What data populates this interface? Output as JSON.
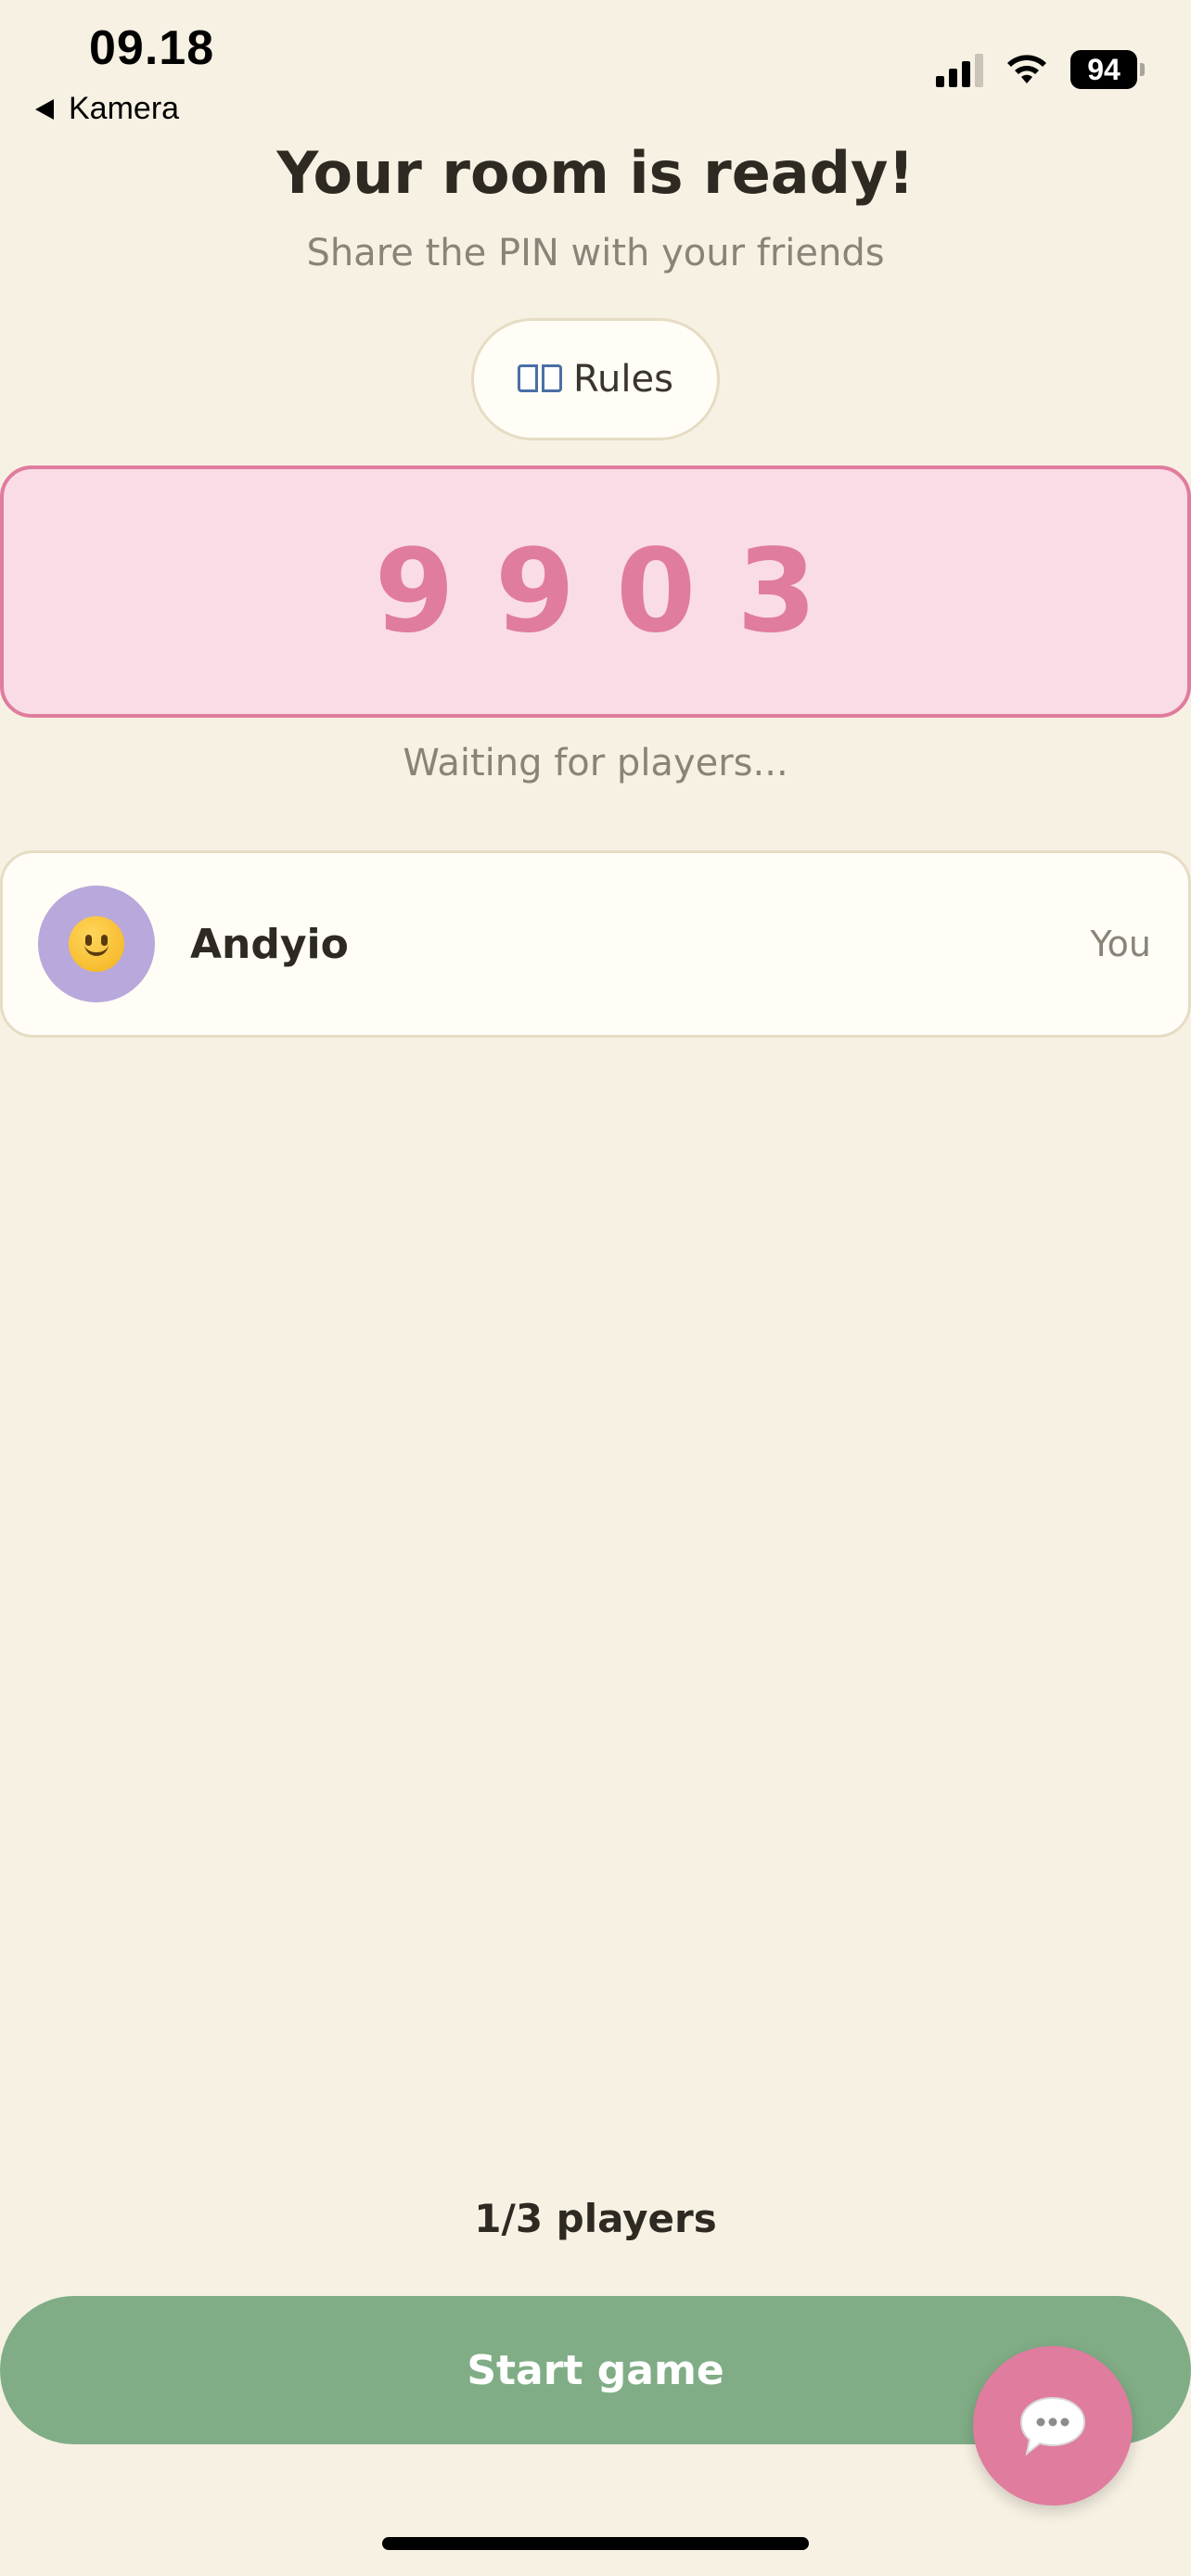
{
  "status_bar": {
    "time": "09.18",
    "back_label": "Kamera",
    "battery": "94"
  },
  "header": {
    "title": "Your room is ready!",
    "subtitle": "Share the PIN with your friends",
    "rules_label": "Rules",
    "rules_icon": "book-icon"
  },
  "room": {
    "pin_digits": [
      "9",
      "9",
      "0",
      "3"
    ],
    "status": "Waiting for players..."
  },
  "players": [
    {
      "name": "Andyio",
      "tag": "You",
      "avatar_emoji": "slightly-smiling-face"
    }
  ],
  "footer": {
    "player_count": "1/3 players",
    "start_label": "Start game",
    "chat_icon": "chat-bubble-icon"
  },
  "colors": {
    "background": "#f7f1e3",
    "accent_pink": "#e07c9e",
    "pin_bg": "#f9dce6",
    "start_green": "#80ad86",
    "avatar_purple": "#b9a8db"
  }
}
